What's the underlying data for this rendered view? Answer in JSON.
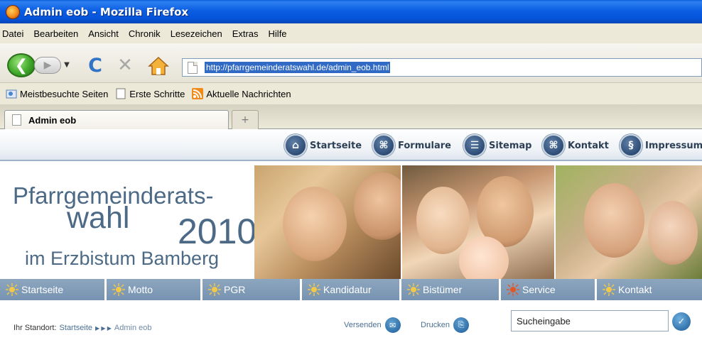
{
  "window": {
    "title": "Admin eob - Mozilla Firefox"
  },
  "menu": [
    "Datei",
    "Bearbeiten",
    "Ansicht",
    "Chronik",
    "Lesezeichen",
    "Extras",
    "Hilfe"
  ],
  "url": "http://pfarrgemeinderatswahl.de/admin_eob.html",
  "bookmarks": [
    "Meistbesuchte Seiten",
    "Erste Schritte",
    "Aktuelle Nachrichten"
  ],
  "tab": {
    "title": "Admin eob",
    "new_tab_label": "+"
  },
  "topnav": [
    "Startseite",
    "Formulare",
    "Sitemap",
    "Kontakt",
    "Impressum"
  ],
  "hero": {
    "line1": "Pfarrgemeinderats-",
    "line2": "wahl",
    "line3": "2010",
    "line4": "im Erzbistum Bamberg"
  },
  "categories": [
    "Startseite",
    "Motto",
    "PGR",
    "Kandidatur",
    "Bistümer",
    "Service",
    "Kontakt"
  ],
  "breadcrumb": {
    "label": "Ihr Standort:",
    "home": "Startseite",
    "current": "Admin eob"
  },
  "actions": {
    "send": "Versenden",
    "print": "Drucken"
  },
  "search": {
    "value": "Sucheingabe"
  },
  "colors": {
    "accent": "#2d4d77",
    "nav": "#8da6bf",
    "service": "#c9502a"
  }
}
